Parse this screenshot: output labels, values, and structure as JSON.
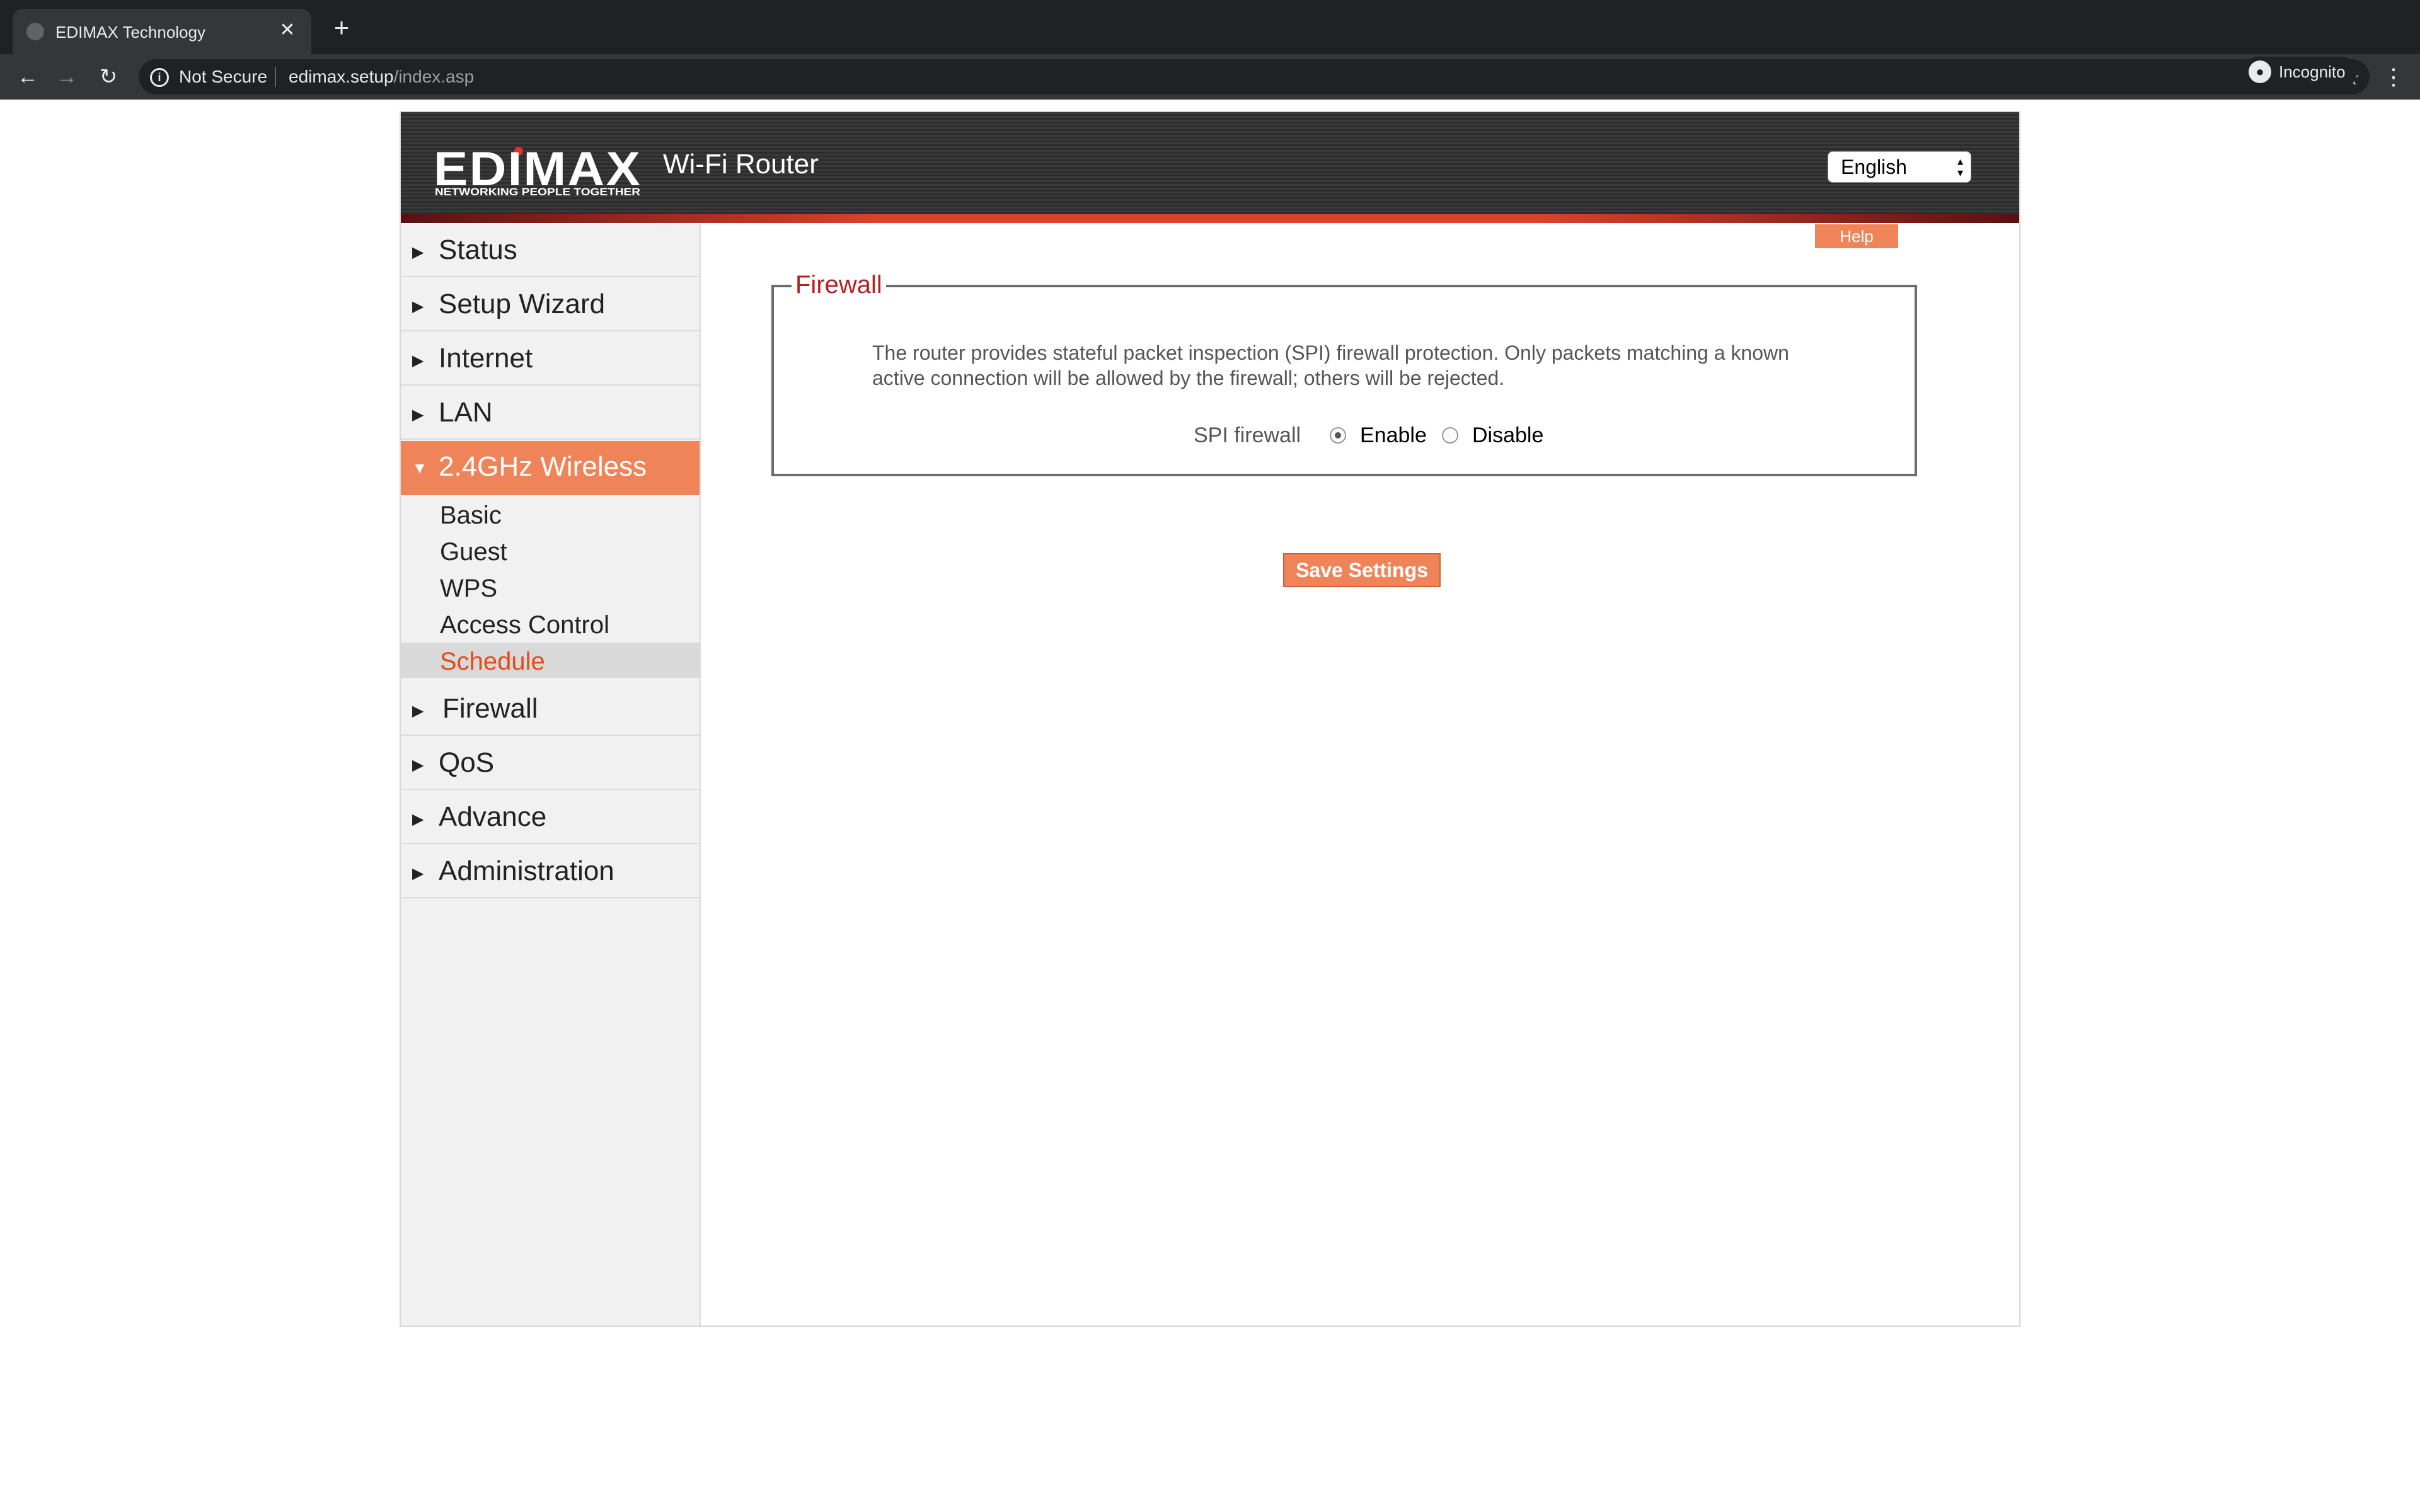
{
  "browser": {
    "tab_title": "EDIMAX Technology",
    "tab_close": "✕",
    "new_tab": "+",
    "security_label": "Not Secure",
    "url_host": "edimax.setup",
    "url_path": "/index.asp",
    "profile_label": "Incognito"
  },
  "header": {
    "logo_text": "EDIMAX",
    "logo_tagline": "NETWORKING PEOPLE TOGETHER",
    "product_title": "Wi-Fi Router",
    "language": "English"
  },
  "sidebar": {
    "items": [
      {
        "label": "Status",
        "arrow": "▶"
      },
      {
        "label": "Setup Wizard",
        "arrow": "▶"
      },
      {
        "label": "Internet",
        "arrow": "▶"
      },
      {
        "label": "LAN",
        "arrow": "▶"
      },
      {
        "label": "2.4GHz Wireless",
        "arrow": "▼"
      },
      {
        "label": "Firewall",
        "arrow": "▶"
      },
      {
        "label": "QoS",
        "arrow": "▶"
      },
      {
        "label": "Advance",
        "arrow": "▶"
      },
      {
        "label": "Administration",
        "arrow": "▶"
      }
    ],
    "subitems": [
      "Basic",
      "Guest",
      "WPS",
      "Access Control",
      "Schedule"
    ],
    "selected_subitem": "Schedule"
  },
  "content": {
    "help_label": "Help",
    "section_title": "Firewall",
    "description": "The router provides stateful packet inspection (SPI) firewall protection. Only packets matching a known active connection will be allowed by the firewall; others will be rejected.",
    "spi_label": "SPI firewall",
    "enable_label": "Enable",
    "disable_label": "Disable",
    "spi_selected": "Enable",
    "save_label": "Save Settings"
  },
  "colors": {
    "accent": "#ef8459",
    "legend_red": "#b22222",
    "selected_text": "#e64a19"
  }
}
